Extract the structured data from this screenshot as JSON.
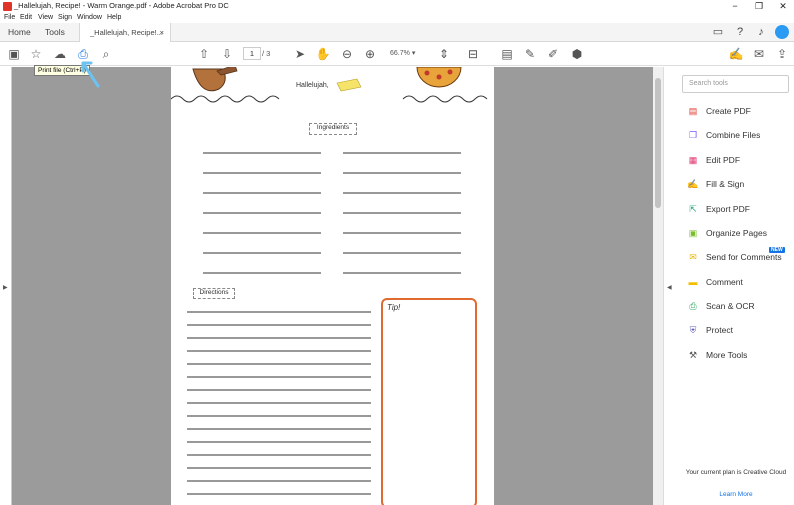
{
  "window": {
    "title": "_Hallelujah, Recipe! - Warm Orange.pdf - Adobe Acrobat Pro DC",
    "minimize": "−",
    "restore": "❐",
    "close": "✕"
  },
  "menu": [
    "File",
    "Edit",
    "View",
    "Sign",
    "Window",
    "Help"
  ],
  "tabs": {
    "home": "Home",
    "tools": "Tools",
    "document": "_Hallelujah, Recipe!...",
    "close": "×"
  },
  "toolbar": {
    "page_current": "1",
    "page_total": "/ 3",
    "zoom": "66.7%",
    "tooltip": "Print file (Ctrl+P)"
  },
  "document": {
    "header_text": "Hallelujah,",
    "ingredients_label": "Ingredients",
    "directions_label": "Directions",
    "tip_label": "Tip!"
  },
  "right_panel": {
    "search_placeholder": "Search tools",
    "tools": [
      {
        "label": "Create PDF",
        "icon": "create-pdf-icon",
        "color": "#e0342a"
      },
      {
        "label": "Combine Files",
        "icon": "combine-files-icon",
        "color": "#7a5af8"
      },
      {
        "label": "Edit PDF",
        "icon": "edit-pdf-icon",
        "color": "#e0346e"
      },
      {
        "label": "Fill & Sign",
        "icon": "fill-sign-icon",
        "color": "#9b59d6"
      },
      {
        "label": "Export PDF",
        "icon": "export-pdf-icon",
        "color": "#1fa47c"
      },
      {
        "label": "Organize Pages",
        "icon": "organize-pages-icon",
        "color": "#7cbd2e"
      },
      {
        "label": "Send for Comments",
        "icon": "send-comments-icon",
        "color": "#e8b711"
      },
      {
        "label": "Comment",
        "icon": "comment-icon",
        "color": "#f2c000"
      },
      {
        "label": "Scan & OCR",
        "icon": "scan-ocr-icon",
        "color": "#2ea85c"
      },
      {
        "label": "Protect",
        "icon": "protect-icon",
        "color": "#5d5fbe"
      },
      {
        "label": "More Tools",
        "icon": "more-tools-icon",
        "color": "#555555"
      }
    ],
    "new_badge": "NEW",
    "plan_text": "Your current plan is Creative Cloud",
    "learn_more": "Learn More"
  },
  "colors": {
    "accent": "#1473e6",
    "tip_border": "#e06a30",
    "canvas": "#9b9b9b"
  }
}
